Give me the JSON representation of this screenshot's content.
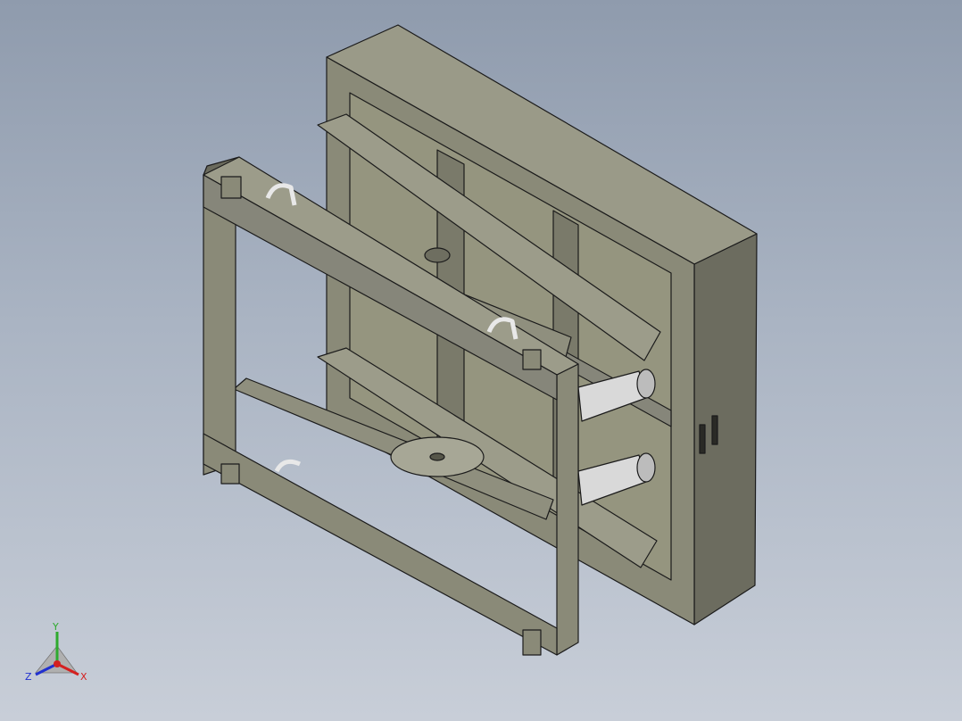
{
  "viewport": {
    "background_top": "#8f9bad",
    "background_bottom": "#c8ced8",
    "model_fill": "#8a8a78",
    "model_fill_light": "#a4a493",
    "model_fill_dark": "#5e5e52",
    "edge_color": "#1b1b1b",
    "cylinder_color": "#d9d9d9"
  },
  "triad": {
    "x_label": "X",
    "y_label": "Y",
    "z_label": "Z",
    "x_color": "#d42020",
    "y_color": "#2eaa2e",
    "z_color": "#2030d0"
  }
}
